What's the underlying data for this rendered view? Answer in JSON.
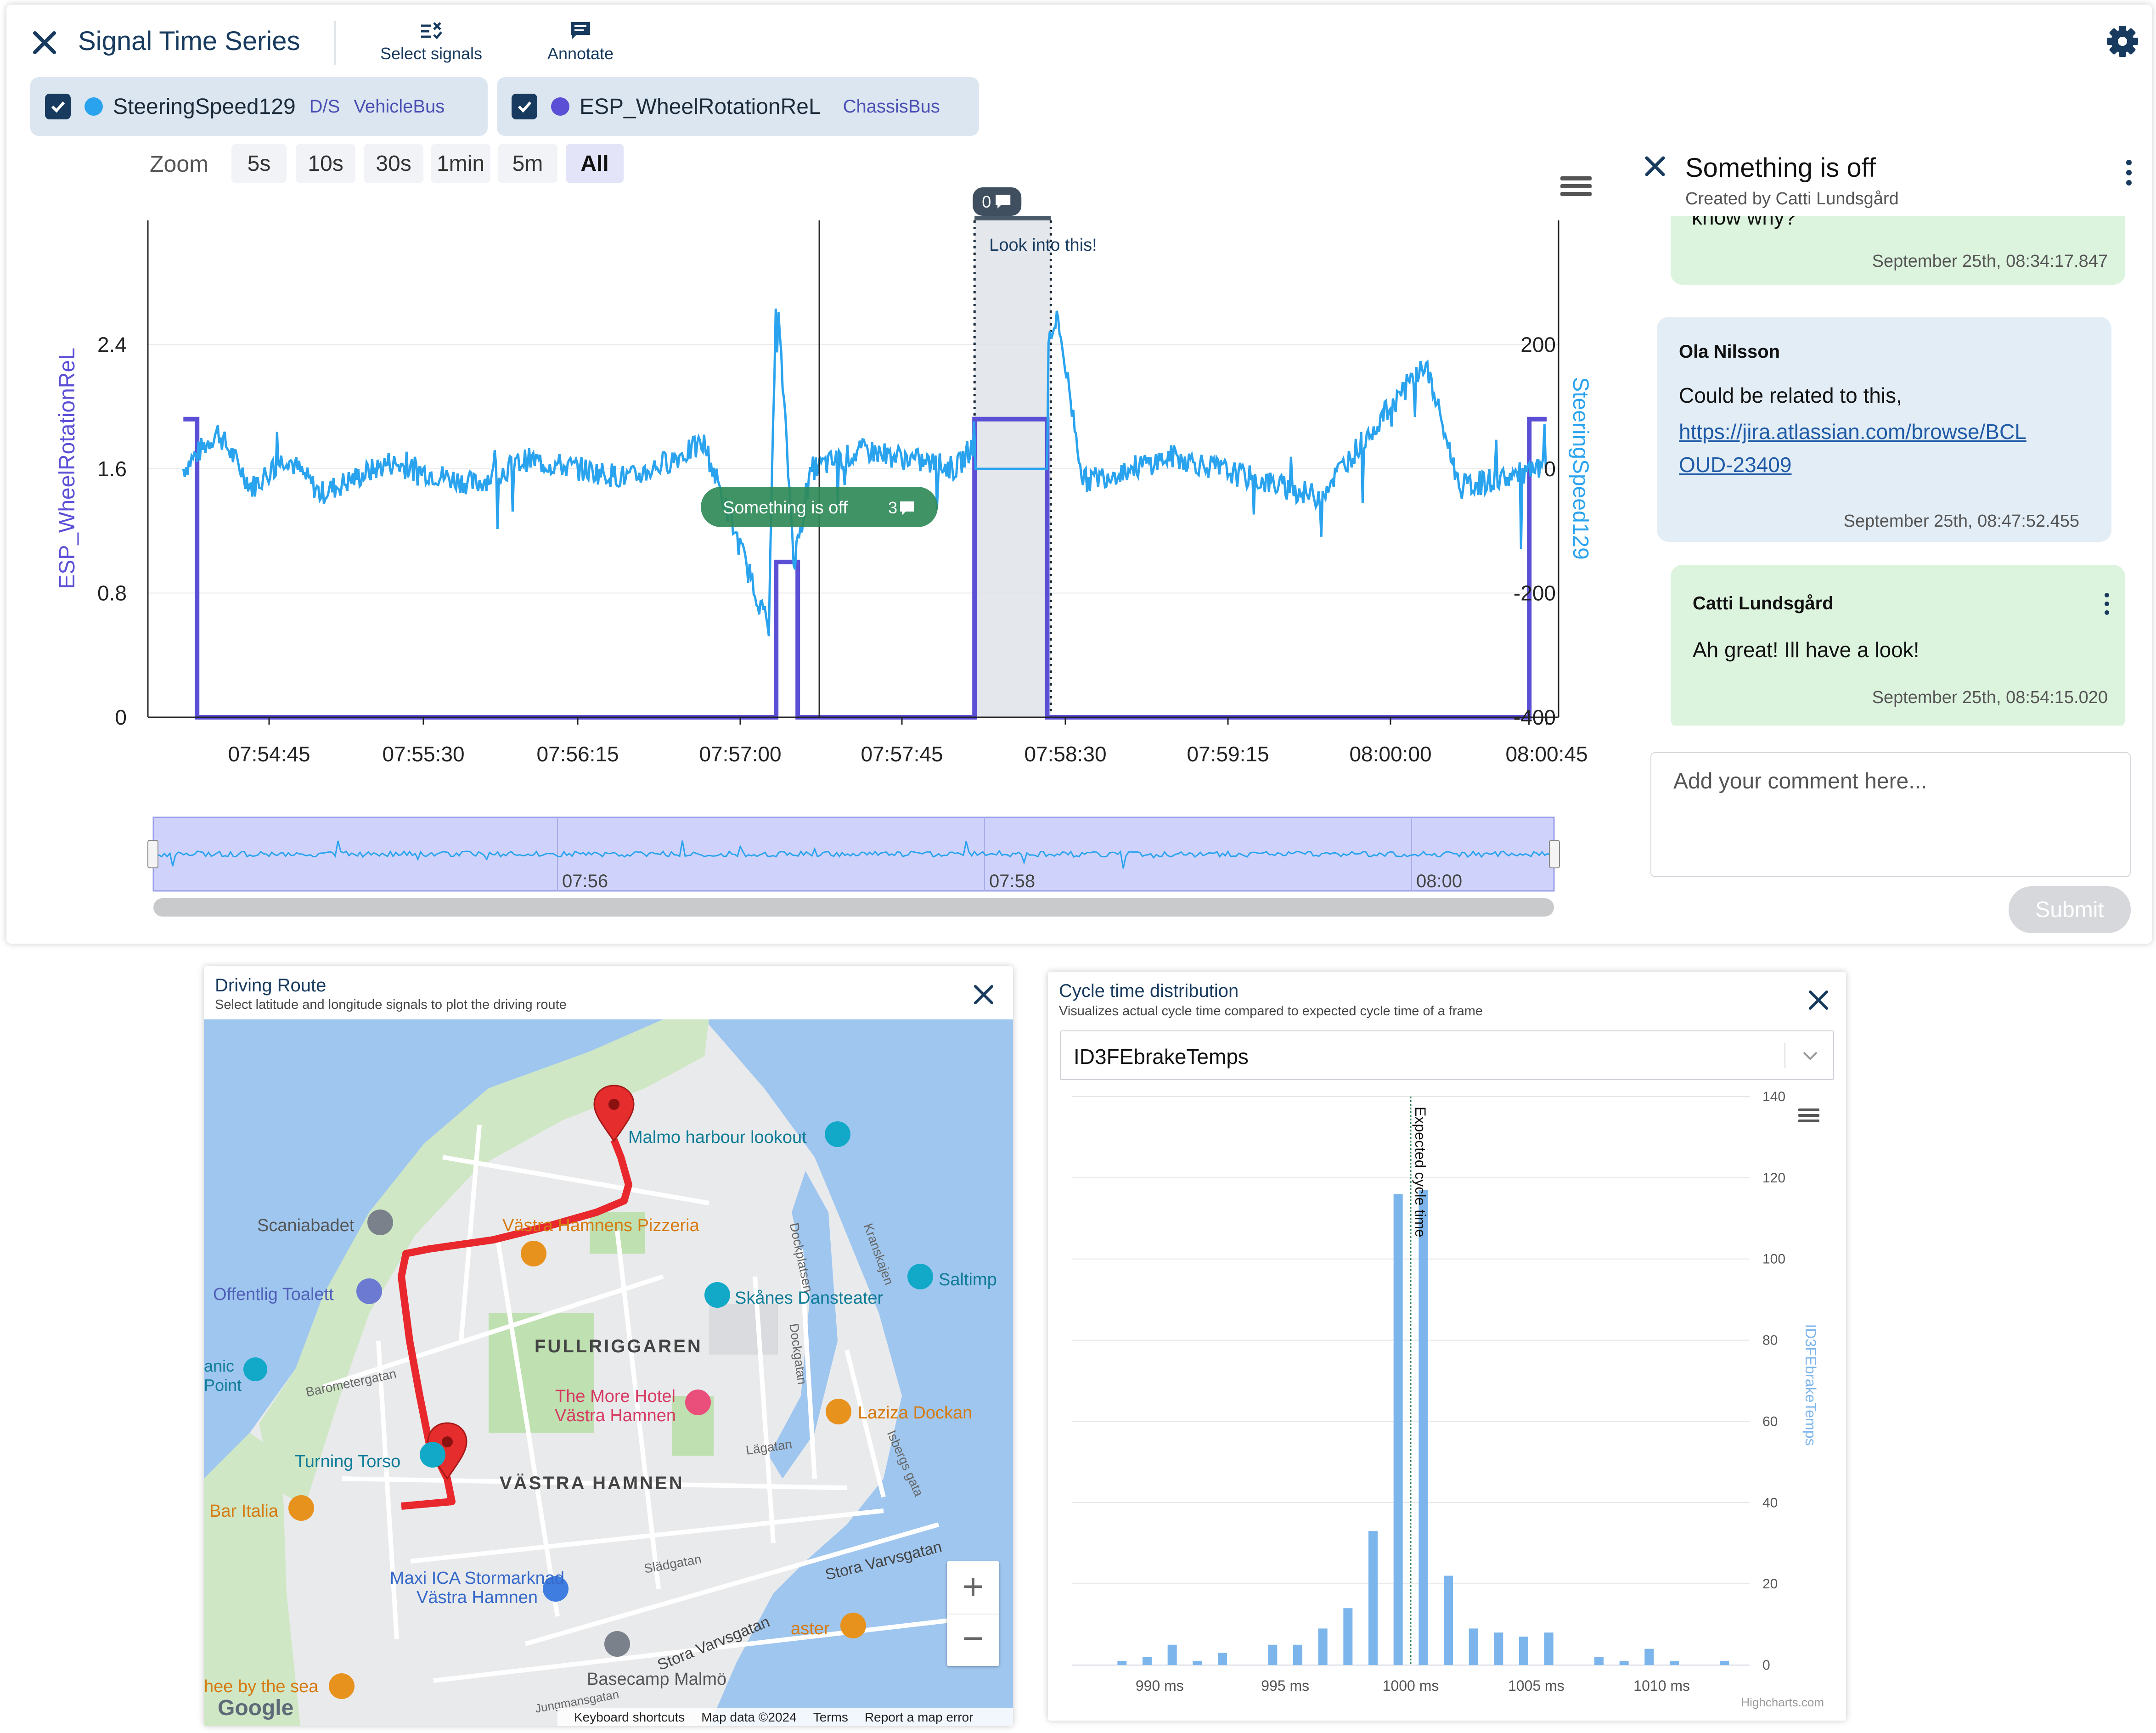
{
  "app": {
    "title": "Signal Time Series",
    "toolbar": {
      "select_signals": "Select signals",
      "annotate": "Annotate"
    },
    "icons": {
      "close": "close-icon",
      "settings": "gear-icon",
      "select_signals": "select-signals-icon",
      "annotate": "comment-icon",
      "menu": "hamburger-menu-icon"
    }
  },
  "signals": [
    {
      "name": "SteeringSpeed129",
      "unit": "D/S",
      "bus": "VehicleBus",
      "color": "#2aa3ef",
      "checked": true
    },
    {
      "name": "ESP_WheelRotationReL",
      "unit": "",
      "bus": "ChassisBus",
      "color": "#5b4fd6",
      "checked": true
    }
  ],
  "zoom": {
    "label": "Zoom",
    "options": [
      "5s",
      "10s",
      "30s",
      "1min",
      "5m",
      "All"
    ],
    "selected": "All"
  },
  "chart_data": [
    {
      "type": "line",
      "y_left": {
        "title": "ESP_WheelRotationReL",
        "ticks": [
          "0",
          "0.8",
          "1.6",
          "2.4"
        ],
        "range": [
          0,
          3.2
        ]
      },
      "y_right": {
        "title": "SteeringSpeed129",
        "ticks": [
          "-400",
          "-200",
          "0",
          "200"
        ],
        "range": [
          -400,
          400
        ]
      },
      "x_ticks": [
        "07:54:45",
        "07:55:30",
        "07:56:15",
        "07:57:00",
        "07:57:45",
        "07:58:30",
        "07:59:15",
        "08:00:00",
        "08:00:45"
      ],
      "annotations": [
        {
          "label": "Look into this!",
          "count": "0",
          "range": [
            "07:58:05",
            "07:58:26"
          ]
        },
        {
          "label": "Something is off",
          "count": "3",
          "at": "07:57:22"
        }
      ],
      "series": [
        {
          "name": "ESP_WheelRotationReL",
          "axis": "left",
          "color": "#5b4fd6",
          "points": [
            [
              "07:54:20",
              1.92
            ],
            [
              "07:54:24",
              1.92
            ],
            [
              "07:54:24",
              0
            ],
            [
              "07:57:10",
              0
            ],
            [
              "07:57:10",
              1.0
            ],
            [
              "07:57:16",
              1.0
            ],
            [
              "07:57:16",
              0
            ],
            [
              "07:58:05",
              0
            ],
            [
              "07:58:05",
              1.92
            ],
            [
              "07:58:25",
              1.92
            ],
            [
              "07:58:25",
              0
            ],
            [
              "08:00:40",
              0
            ],
            [
              "08:00:40",
              1.92
            ],
            [
              "08:00:45",
              1.92
            ]
          ]
        },
        {
          "name": "SteeringSpeed129",
          "axis": "right",
          "color": "#2aa3ef",
          "points": [
            [
              "07:54:20",
              0
            ],
            [
              "07:54:30",
              60
            ],
            [
              "07:54:40",
              -30
            ],
            [
              "07:54:50",
              20
            ],
            [
              "07:55:00",
              -40
            ],
            [
              "07:55:20",
              10
            ],
            [
              "07:55:45",
              -25
            ],
            [
              "07:56:00",
              15
            ],
            [
              "07:56:30",
              -15
            ],
            [
              "07:56:50",
              40
            ],
            [
              "07:57:08",
              -260
            ],
            [
              "07:57:10",
              300
            ],
            [
              "07:57:15",
              -150
            ],
            [
              "07:57:20",
              0
            ],
            [
              "07:57:35",
              30
            ],
            [
              "07:58:00",
              0
            ],
            [
              "07:58:28",
              240
            ],
            [
              "07:58:35",
              -20
            ],
            [
              "07:59:00",
              20
            ],
            [
              "07:59:40",
              -45
            ],
            [
              "08:00:10",
              170
            ],
            [
              "08:00:20",
              -30
            ],
            [
              "08:00:45",
              0
            ]
          ]
        }
      ]
    },
    {
      "type": "bar",
      "title": "Cycle time distribution",
      "subtitle": "Visualizes actual cycle time compared to expected cycle time of a frame",
      "series": [
        {
          "name": "ID3FEbrakeTemps",
          "color": "#7cb5ec"
        }
      ],
      "xlabel": "",
      "ylabel": "ID3FEbrakeTemps",
      "x_ticks": [
        "990 ms",
        "995 ms",
        "1000 ms",
        "1005 ms",
        "1010 ms"
      ],
      "y_ticks": [
        "0",
        "20",
        "40",
        "60",
        "80",
        "100",
        "120",
        "140"
      ],
      "ylim": [
        0,
        140
      ],
      "plot_line": {
        "label": "Expected cycle time",
        "x": 1000
      },
      "bars": [
        [
          988.5,
          1
        ],
        [
          989.5,
          2
        ],
        [
          990.5,
          5
        ],
        [
          991.5,
          1
        ],
        [
          992.5,
          3
        ],
        [
          994.5,
          5
        ],
        [
          995.5,
          5
        ],
        [
          996.5,
          9
        ],
        [
          997.5,
          14
        ],
        [
          998.5,
          33
        ],
        [
          999.5,
          116
        ],
        [
          1000.5,
          117
        ],
        [
          1001.5,
          22
        ],
        [
          1002.5,
          9
        ],
        [
          1003.5,
          8
        ],
        [
          1004.5,
          7
        ],
        [
          1005.5,
          8
        ],
        [
          1007.5,
          2
        ],
        [
          1008.5,
          1
        ],
        [
          1009.5,
          4
        ],
        [
          1010.5,
          1
        ],
        [
          1012.5,
          1
        ]
      ],
      "credit": "Highcharts.com"
    }
  ],
  "navigator": {
    "labels": [
      "07:56",
      "07:58",
      "08:00"
    ]
  },
  "comment_panel": {
    "title": "Something is off",
    "created_by": "Created by Catti Lundsgård",
    "comments": [
      {
        "author": "",
        "text": "know why?",
        "timestamp": "September 25th, 08:34:17.847",
        "color": "#dcf3dd"
      },
      {
        "author": "Ola Nilsson",
        "text": "Could be related to this,",
        "link": "https://jira.atlassian.com/browse/BCLOUD-23409",
        "link_line1": "https://jira.atlassian.com/browse/BCL",
        "link_line2": "OUD-23409",
        "timestamp": "September 25th, 08:47:52.455",
        "color": "#e2edf6"
      },
      {
        "author": "Catti Lundsgård",
        "text": "Ah great! Ill have a look!",
        "timestamp": "September 25th, 08:54:15.020",
        "color": "#dcf3dd"
      }
    ],
    "input_placeholder": "Add your comment here...",
    "submit": "Submit"
  },
  "map_panel": {
    "title": "Driving Route",
    "subtitle": "Select latitude and longitude signals to plot the driving route",
    "places": {
      "harbour": "Malmo harbour lookout",
      "scaniabadet": "Scaniabadet",
      "pizzeria": "Västra Hamnens Pizzeria",
      "saltimp": "Saltimp",
      "toalett": "Offentlig Toalett",
      "dansteater": "Skånes Dansteater",
      "fullriggaren": "FULLRIGGAREN",
      "point": "anic Point",
      "baro": "Barometergatan",
      "hotel": "The More Hotel Västra Hamnen",
      "laziza": "Laziza Dockan",
      "torso": "Turning Torso",
      "vastra": "VÄSTRA HAMNEN",
      "lagatan": "Lägatan",
      "bar_italia": "Bar Italia",
      "ica": "Maxi ICA Stormarknad Västra Hamnen",
      "basecamp": "Basecamp Malmö",
      "coffee": "hee by the sea",
      "aster": "aster",
      "stora1": "Stora Varvsgatan",
      "stora2": "Stora Varvsgatan",
      "sladgatan": "Slädgatan",
      "dockplatsen": "Dockplatsen",
      "kranskajen": "Kranskajen",
      "dockgatan": "Dockgatan",
      "isbergs": "Isbergs gata",
      "jungman": "Jungmansgatan"
    },
    "zoom_in": "+",
    "zoom_out": "−",
    "attribution": {
      "google": "Google",
      "shortcuts": "Keyboard shortcuts",
      "mapdata": "Map data ©2024",
      "terms": "Terms",
      "report": "Report a map error"
    }
  },
  "cycle_panel": {
    "title": "Cycle time distribution",
    "subtitle": "Visualizes actual cycle time compared to expected cycle time of a frame",
    "selected_frame": "ID3FEbrakeTemps"
  }
}
